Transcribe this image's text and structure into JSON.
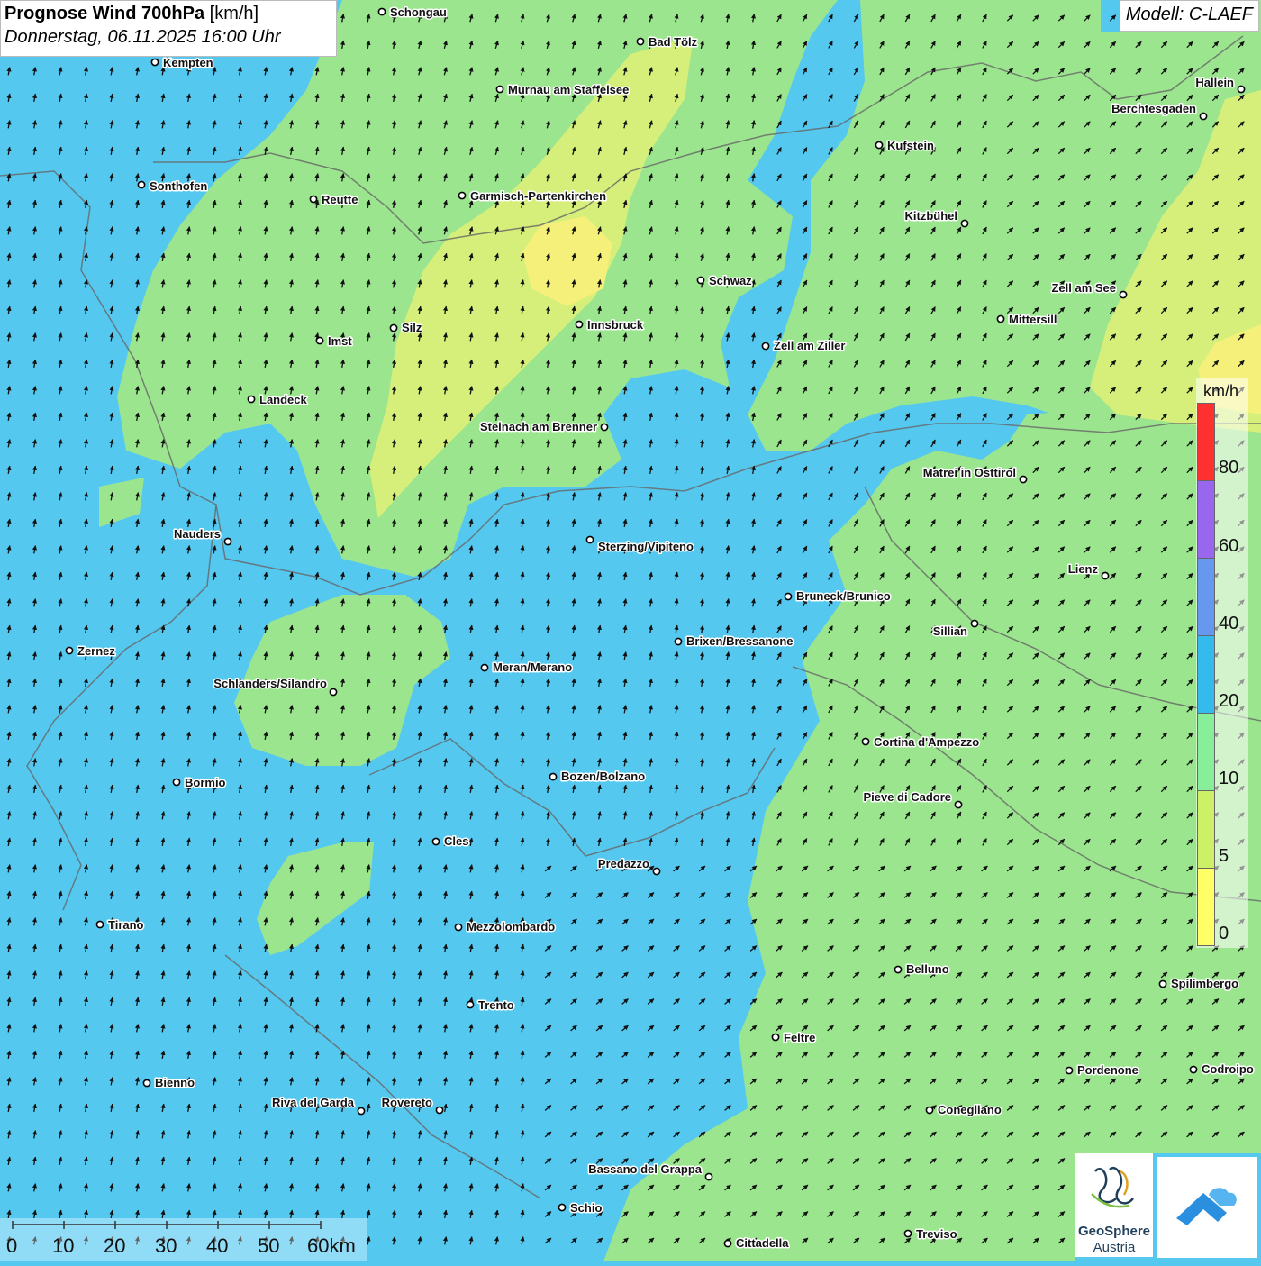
{
  "header": {
    "title_bold": "Prognose Wind 700hPa",
    "title_unit": "[km/h]",
    "datetime": "Donnerstag, 06.11.2025 16:00 Uhr",
    "model": "Modell: C-LAEF"
  },
  "legend": {
    "unit": "km/h",
    "ticks": [
      "80",
      "60",
      "40",
      "20",
      "10",
      "5",
      "0"
    ],
    "colors": {
      "band_80_plus": "#ff3030",
      "band_60_80": "#9966ee",
      "band_40_60": "#6699ee",
      "band_20_40": "#33bbee",
      "band_10_20": "#88ee99",
      "band_5_10": "#ccf066",
      "band_0_5": "#ffff66"
    }
  },
  "map_colors": {
    "calm_0_5": "#f4f07a",
    "light_5_10": "#d6ef7a",
    "moderate_10_20": "#9be58e",
    "fresh_20_40": "#55c8f0"
  },
  "cities": [
    "Schongau",
    "Kempten",
    "Bad Tölz",
    "Murnau am Staffelsee",
    "Hallein",
    "Berchtesgaden",
    "Kufstein",
    "Sonthofen",
    "Reutte",
    "Garmisch-Partenkirchen",
    "Kitzbühel",
    "Schwaz",
    "Zell am See",
    "Mittersill",
    "Imst",
    "Silz",
    "Innsbruck",
    "Zell am Ziller",
    "Landeck",
    "Steinach am Brenner",
    "Matrei in Osttirol",
    "Nauders",
    "Sterzing/Vipiteno",
    "Lienz",
    "Bruneck/Brunico",
    "Sillian",
    "Zernez",
    "Brixen/Bressanone",
    "Meran/Merano",
    "Schlanders/Silandro",
    "Cortina d'Ampezzo",
    "Bormio",
    "Bozen/Bolzano",
    "Pieve di Cadore",
    "Cles",
    "Predazzo",
    "Tirano",
    "Mezzolombardo",
    "Belluno",
    "Spilimbergo",
    "Trento",
    "Feltre",
    "Bienno",
    "Pordenone",
    "Codroipo",
    "Riva del Garda",
    "Rovereto",
    "Conegliano",
    "Bassano del Grappa",
    "Schio",
    "Treviso",
    "Cittadella"
  ],
  "scale": {
    "ticks": [
      "0",
      "10",
      "20",
      "30",
      "40",
      "50",
      "60km"
    ]
  },
  "logos": {
    "geosphere_line1": "GeoSphere",
    "geosphere_line2": "Austria"
  }
}
